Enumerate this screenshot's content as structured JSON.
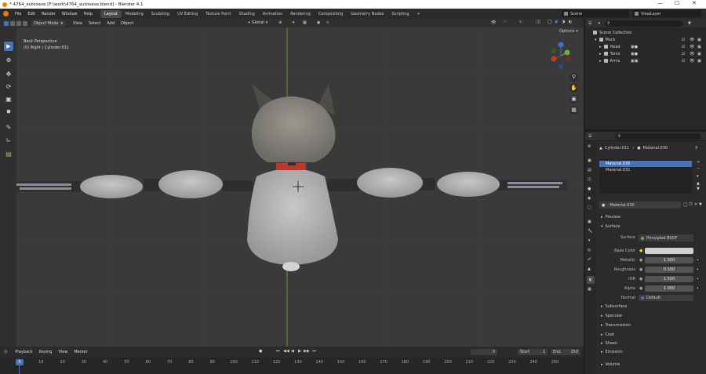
{
  "window": {
    "title": "* 4764_autosave [F:\\work\\4764_autosave.blend] - Blender 4.1"
  },
  "menu": [
    "File",
    "Edit",
    "Render",
    "Window",
    "Help"
  ],
  "workspaces": [
    "Layout",
    "Modeling",
    "Sculpting",
    "UV Editing",
    "Texture Paint",
    "Shading",
    "Animation",
    "Rendering",
    "Compositing",
    "Geometry Nodes",
    "Scripting"
  ],
  "scene": {
    "name": "Scene",
    "view_layer": "ViewLayer"
  },
  "viewport": {
    "mode": "Object Mode",
    "menus": [
      "View",
      "Select",
      "Add",
      "Object"
    ],
    "orientation": "Global",
    "options": "Options",
    "perspective": "Back Perspective",
    "object_info": "(0) Right | Cylinder.011"
  },
  "outliner": {
    "search_placeholder": "",
    "items": [
      {
        "label": "Scene Collection",
        "indent": 0
      },
      {
        "label": "Mock",
        "indent": 1
      },
      {
        "label": "Head",
        "indent": 2
      },
      {
        "label": "Torso",
        "indent": 2
      },
      {
        "label": "Arms",
        "indent": 2
      }
    ]
  },
  "properties": {
    "search_placeholder": "",
    "breadcrumb_object": "Cylinder.011",
    "breadcrumb_material": "Material.030",
    "material_slots": [
      "Material.030",
      "Material.031"
    ],
    "material_name": "Material.030",
    "sections": {
      "preview": "Preview",
      "surface": "Surface"
    },
    "surface_label": "Surface",
    "surface_value": "Principled BSDF",
    "fields": [
      {
        "label": "Base Color",
        "value": ""
      },
      {
        "label": "Metallic",
        "value": "1.000"
      },
      {
        "label": "Roughness",
        "value": "0.500"
      },
      {
        "label": "IOR",
        "value": "1.500"
      },
      {
        "label": "Alpha",
        "value": "1.000"
      },
      {
        "label": "Normal",
        "value": "Default"
      }
    ],
    "subsections": [
      "Subsurface",
      "Specular",
      "Transmission",
      "Coat",
      "Sheen",
      "Emission",
      "Volume"
    ]
  },
  "timeline": {
    "menus": [
      "Playback",
      "Keying",
      "View",
      "Marker"
    ],
    "current_frame": "0",
    "start_label": "Start",
    "start": "1",
    "end_label": "End",
    "end": "250",
    "ruler": [
      "0",
      "10",
      "20",
      "30",
      "40",
      "50",
      "60",
      "70",
      "80",
      "90",
      "100",
      "110",
      "120",
      "130",
      "140",
      "150",
      "160",
      "170",
      "180",
      "190",
      "200",
      "210",
      "220",
      "230",
      "240",
      "250"
    ],
    "playhead": "0"
  },
  "colors": {
    "accent": "#4772b3",
    "active_tab": "#4a4a4a",
    "x_axis": "#c0392b",
    "y_axis": "#6fae3a",
    "z_axis": "#3d6fd1"
  }
}
